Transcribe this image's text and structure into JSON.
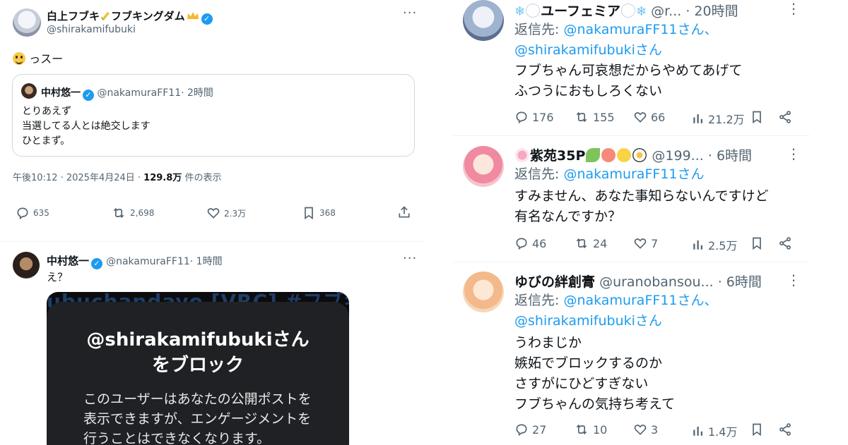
{
  "left": {
    "tweet1": {
      "display_name": "白上フブキ",
      "display_name_suffix": "フブキングダム",
      "handle": "@shirakamifubuki",
      "more": "···",
      "text": "っスー",
      "quote": {
        "display_name": "中村悠一",
        "handle": "@nakamuraFF11",
        "time": "· 2時間",
        "lines": [
          "とりあえず",
          "当選してる人とは絶交します",
          "ひとまず。"
        ]
      },
      "meta_time": "午後10:12 · 2025年4月24日 ·",
      "meta_views": "129.8万",
      "meta_views_suffix": "件の表示",
      "actions": {
        "replies": "635",
        "retweets": "2,698",
        "likes": "2.3万",
        "bookmarks": "368"
      }
    },
    "tweet2": {
      "display_name": "中村悠一",
      "handle": "@nakamuraFF11",
      "time": "· 1時間",
      "more": "···",
      "text": "え？",
      "screenshot": {
        "bg_text": "ubuchandayo [VRC] #フブキングダム",
        "title_line1": "@shirakamifubukiさん",
        "title_line2": "をブロック",
        "body": "このユーザーはあなたの公開ポストを表示できますが、エンゲージメントを行うことはできなくなります。"
      }
    }
  },
  "right": {
    "replies": [
      {
        "display_name": "ユーフェミア",
        "handle": "@r...",
        "time": "· 20時間",
        "reply_label": "返信先:",
        "mention1": "@nakamuraFF11さん、",
        "mention2": "@shirakamifubukiさん",
        "lines": [
          "フブちゃん可哀想だからやめてあげて",
          "ふつうにおもしろくない"
        ],
        "actions": {
          "replies": "176",
          "retweets": "155",
          "likes": "66",
          "views": "21.2万"
        }
      },
      {
        "display_name": "紫苑35P",
        "handle": "@199...",
        "time": "· 6時間",
        "reply_label": "返信先:",
        "mention1": "@nakamuraFF11さん",
        "lines": [
          "すみません、あなた事知らないんですけど",
          "有名なんですか？"
        ],
        "actions": {
          "replies": "46",
          "retweets": "24",
          "likes": "7",
          "views": "2.5万"
        }
      },
      {
        "display_name": "ゆびの絆創膏",
        "handle": "@uranobansou...",
        "time": "· 6時間",
        "reply_label": "返信先:",
        "mention1": "@nakamuraFF11さん、",
        "mention2": "@shirakamifubukiさん",
        "lines": [
          "うわまじか",
          "嫉妬でブロックするのか",
          "さすがにひどすぎない",
          "フブちゃんの気持ち考えて"
        ],
        "actions": {
          "replies": "27",
          "retweets": "10",
          "likes": "3",
          "views": "1.4万"
        }
      }
    ]
  },
  "colors": {
    "accent": "#1d9bf0",
    "secondary_text": "#536471",
    "border": "#cfd9de"
  }
}
